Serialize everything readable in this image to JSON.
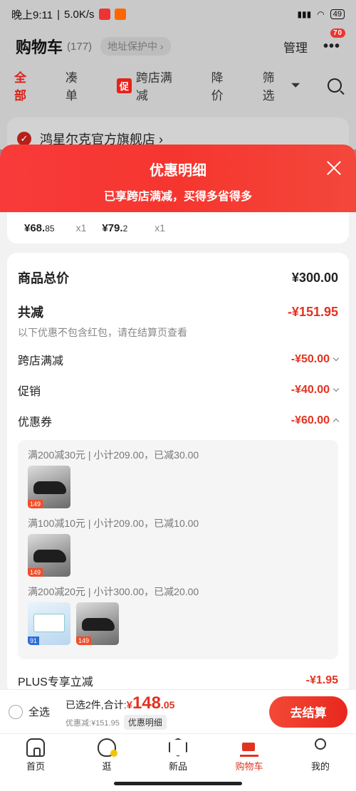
{
  "status_bar": {
    "time": "晚上9:11",
    "speed": "5.0K/s",
    "battery": "49"
  },
  "cart_header": {
    "title": "购物车",
    "count": "(177)",
    "address_protect": "地址保护中 ›",
    "manage": "管理",
    "more_badge": "70"
  },
  "filter_tabs": {
    "all": "全部",
    "bundle": "凑单",
    "promo_tag": "促",
    "cross_store": "跨店满减",
    "price_drop": "降价",
    "filter": "筛选"
  },
  "store": {
    "name": "鸿星尔克官方旗舰店 ›"
  },
  "sheet": {
    "title": "优惠明细",
    "subtitle": "已享跨店满减，买得多省得多"
  },
  "items_row": [
    {
      "price_main": "¥68.",
      "price_dec": "85",
      "qty": "x1"
    },
    {
      "price_main": "¥79.",
      "price_dec": "2",
      "qty": "x1"
    }
  ],
  "detail": {
    "total_label": "商品总价",
    "total_value": "¥300.00",
    "discount_label": "共减",
    "discount_value": "-¥151.95",
    "note": "以下优惠不包含红包，请在结算页查看",
    "cross_store_label": "跨店满减",
    "cross_store_value": "-¥50.00",
    "promo_label": "促销",
    "promo_value": "-¥40.00",
    "coupon_label": "优惠券",
    "coupon_value": "-¥60.00",
    "coupons": [
      {
        "text": "满200减30元 | 小计209.00，已减30.00",
        "thumbs": [
          "shoe"
        ]
      },
      {
        "text": "满100减10元 | 小计209.00，已减10.00",
        "thumbs": [
          "shoe"
        ]
      },
      {
        "text": "满200减20元 | 小计300.00，已减20.00",
        "thumbs": [
          "box",
          "shoe"
        ]
      }
    ],
    "thumb_tags": {
      "shoe": "149",
      "box": "91"
    },
    "plus_label": "PLUS专享立减",
    "plus_value": "-¥1.95"
  },
  "checkout": {
    "select_all": "全选",
    "selected_total": "已选2件,合计:",
    "currency": "¥",
    "price_int": "148",
    "price_dec": ".05",
    "discount_text": "优惠减:¥151.95",
    "detail_chip": "优惠明细",
    "button": "去结算"
  },
  "tab_bar": {
    "home": "首页",
    "browse": "逛",
    "new": "新品",
    "cart": "购物车",
    "me": "我的"
  },
  "colors": {
    "accent": "#e23321",
    "sheet_header": "#f5362f"
  }
}
